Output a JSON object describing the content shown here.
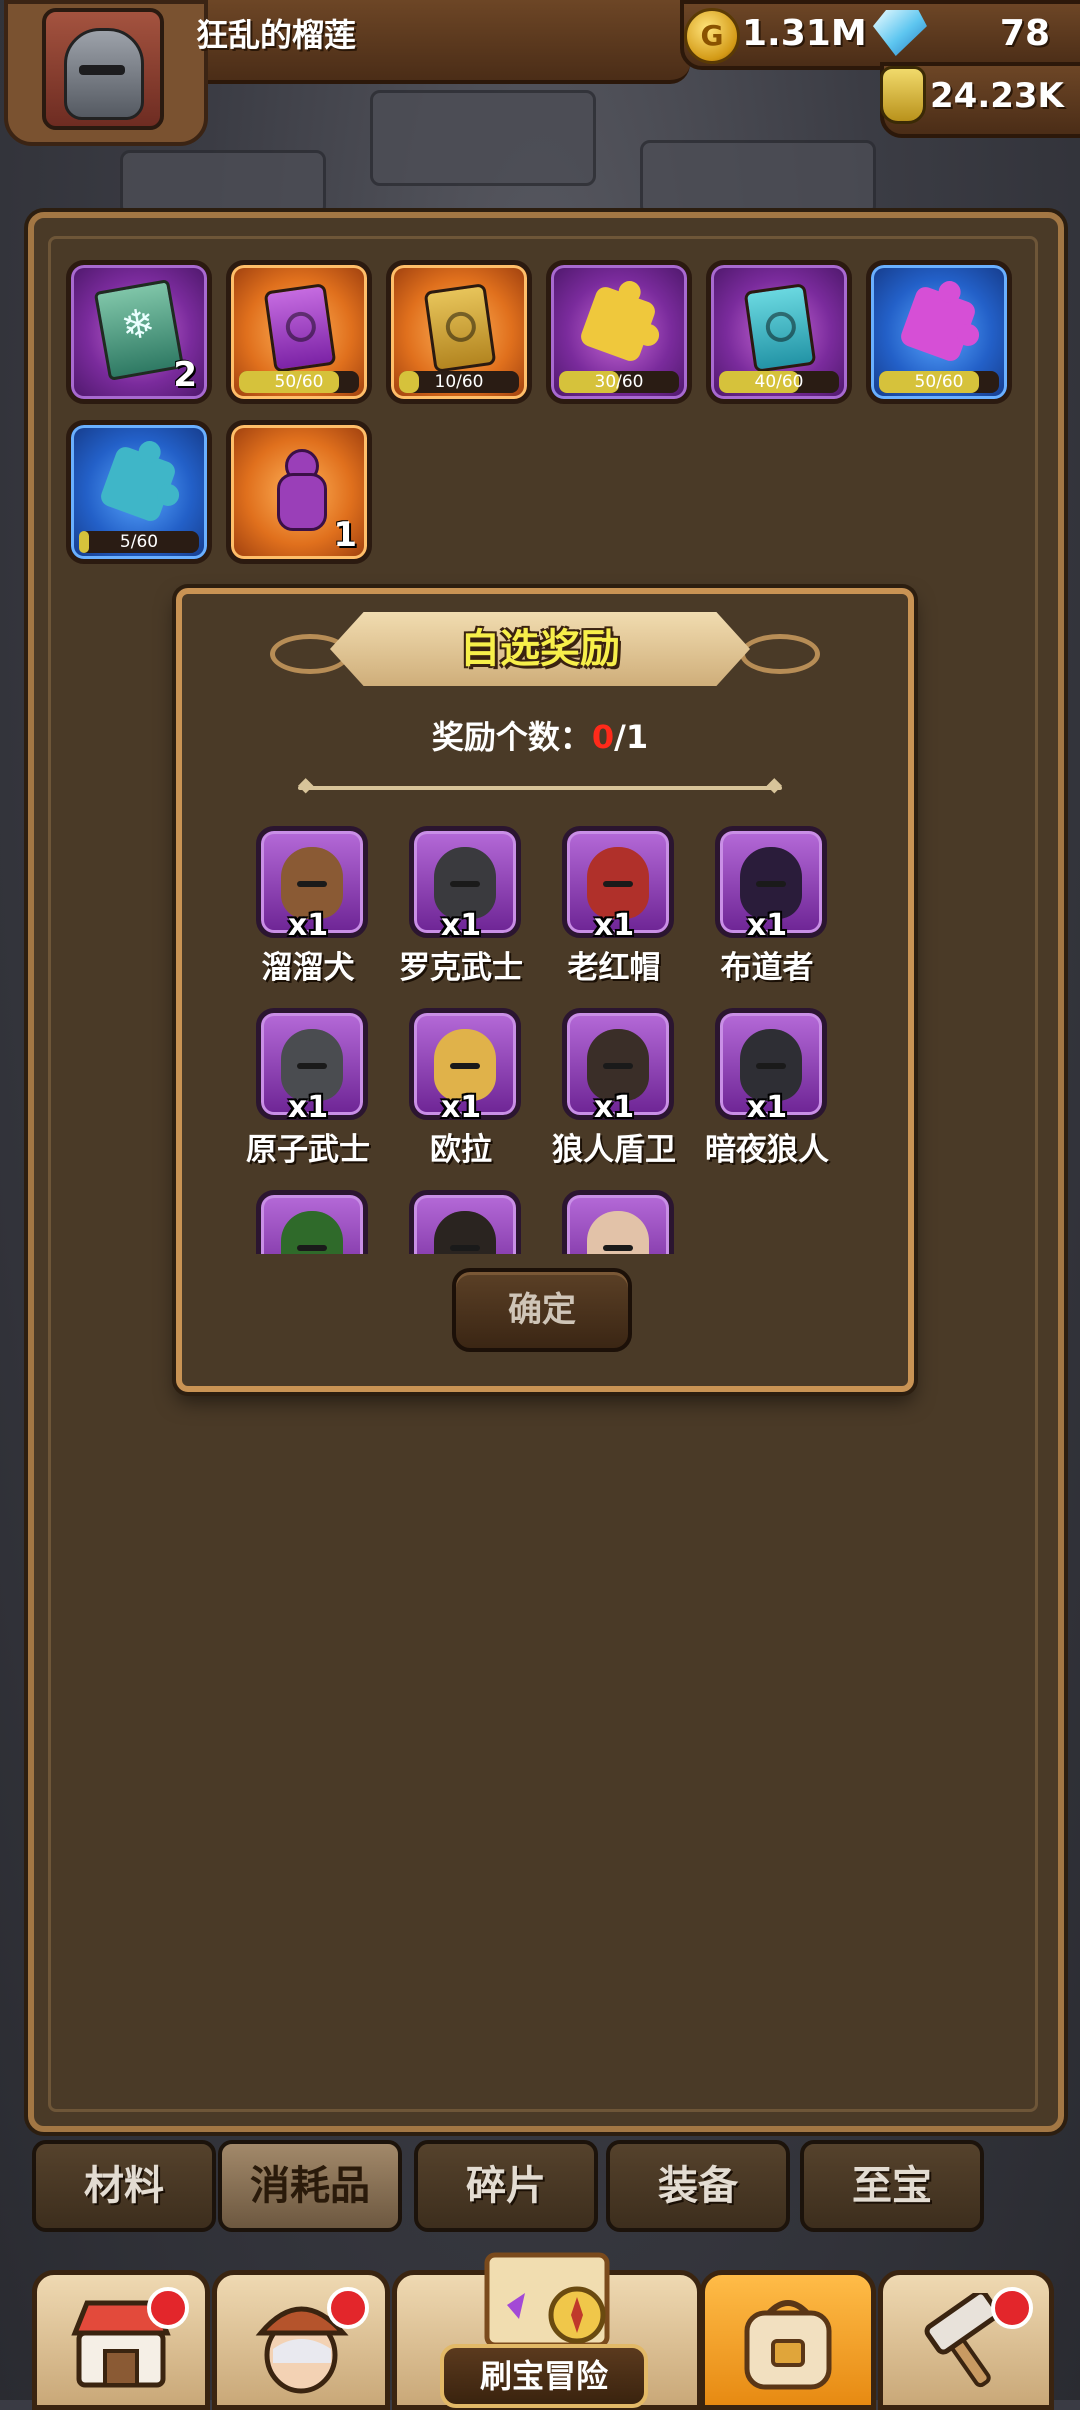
{
  "player": {
    "name": "狂乱的榴莲"
  },
  "resources": {
    "gold": "1.31M",
    "gems": "78",
    "potion": "24.23K"
  },
  "inventory": [
    {
      "icon": "skill-book-icon",
      "rarity": "purple",
      "quantity": "2"
    },
    {
      "icon": "purple-card-icon",
      "rarity": "orange",
      "progress": "50/60",
      "fraction": 0.83
    },
    {
      "icon": "gold-card-icon",
      "rarity": "orange",
      "progress": "10/60",
      "fraction": 0.17
    },
    {
      "icon": "gold-puzzle-piece-icon",
      "rarity": "purple",
      "progress": "30/60",
      "fraction": 0.5
    },
    {
      "icon": "teal-card-icon",
      "rarity": "purple",
      "progress": "40/60",
      "fraction": 0.67
    },
    {
      "icon": "pink-puzzle-piece-icon",
      "rarity": "blue",
      "progress": "50/60",
      "fraction": 0.83
    },
    {
      "icon": "teal-puzzle-piece-icon",
      "rarity": "blue",
      "progress": "5/60",
      "fraction": 0.08
    },
    {
      "icon": "gingerbread-icon",
      "rarity": "orange",
      "quantity": "1"
    }
  ],
  "dialog": {
    "title": "自选奖励",
    "count_label": "奖励个数：",
    "count_current": "0",
    "count_total": "/1",
    "confirm_label": "确定",
    "rewards": [
      {
        "name": "溜溜犬",
        "qty": "x1",
        "face": "#8a5a34"
      },
      {
        "name": "罗克武士",
        "qty": "x1",
        "face": "#3a3a3e"
      },
      {
        "name": "老红帽",
        "qty": "x1",
        "face": "#b0302a"
      },
      {
        "name": "布道者",
        "qty": "x1",
        "face": "#2a1c3a"
      },
      {
        "name": "原子武士",
        "qty": "x1",
        "face": "#4a4c50"
      },
      {
        "name": "欧拉",
        "qty": "x1",
        "face": "#e0b24a"
      },
      {
        "name": "狼人盾卫",
        "qty": "x1",
        "face": "#3a2e28"
      },
      {
        "name": "暗夜狼人",
        "qty": "x1",
        "face": "#2e2e34"
      },
      {
        "name": "",
        "qty": "",
        "face": "#2f6a2a"
      },
      {
        "name": "",
        "qty": "",
        "face": "#2a2420"
      },
      {
        "name": "",
        "qty": "",
        "face": "#e2c2a8"
      }
    ]
  },
  "tabs": [
    "材料",
    "消耗品",
    "碎片",
    "装备",
    "至宝"
  ],
  "active_tab": "消耗品",
  "nav": {
    "adventure_label": "刷宝冒险"
  }
}
